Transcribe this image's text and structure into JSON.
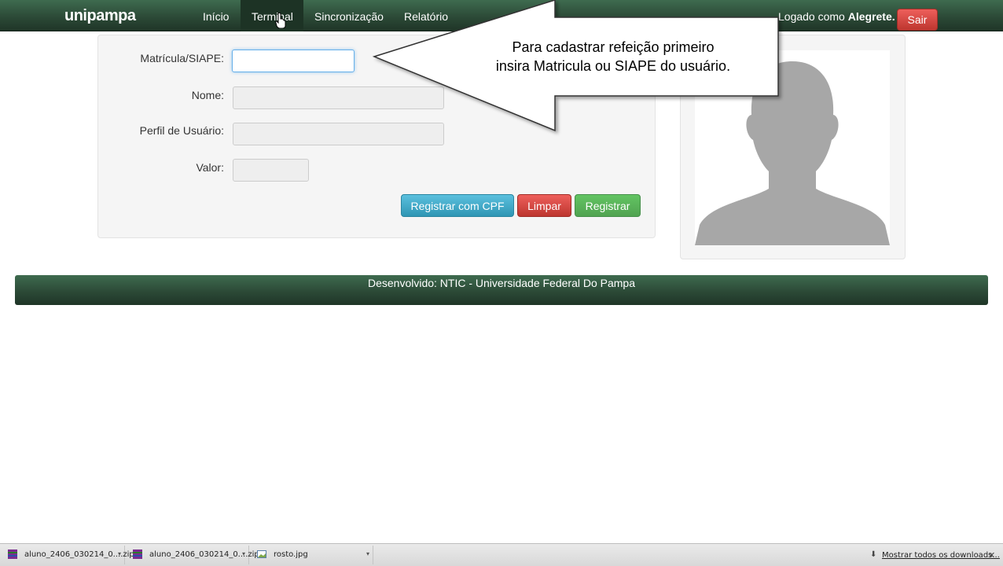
{
  "navbar": {
    "brand": "unipampa",
    "items": [
      {
        "label": "Início"
      },
      {
        "label": "Terminal"
      },
      {
        "label": "Sincronização"
      },
      {
        "label": "Relatório"
      }
    ],
    "login_prefix": "Logado como ",
    "login_user": "Alegrete.",
    "logout_label": "Sair"
  },
  "form": {
    "matricula_label": "Matrícula/SIAPE:",
    "matricula_value": "",
    "nome_label": "Nome:",
    "nome_value": "",
    "perfil_label": "Perfil de Usuário:",
    "perfil_value": "",
    "valor_label": "Valor:",
    "valor_value": "",
    "btn_cpf": "Registrar com CPF",
    "btn_limpar": "Limpar",
    "btn_registrar": "Registrar"
  },
  "callout": {
    "line1": "Para cadastrar refeição primeiro",
    "line2": "insira Matricula ou SIAPE do usuário."
  },
  "footer": {
    "text": "Desenvolvido: NTIC - Universidade Federal Do Pampa"
  },
  "downloads": {
    "items": [
      {
        "name": "aluno_2406_030214_0....zip",
        "icon": "zip-archive-icon"
      },
      {
        "name": "aluno_2406_030214_0....zip",
        "icon": "zip-archive-icon"
      },
      {
        "name": "rosto.jpg",
        "icon": "image-file-icon"
      }
    ],
    "show_all": "Mostrar todos os downloads..."
  },
  "colors": {
    "navbar": "#2c4a37",
    "info": "#5bc0de",
    "danger": "#da4f49",
    "success": "#5bb75b"
  }
}
